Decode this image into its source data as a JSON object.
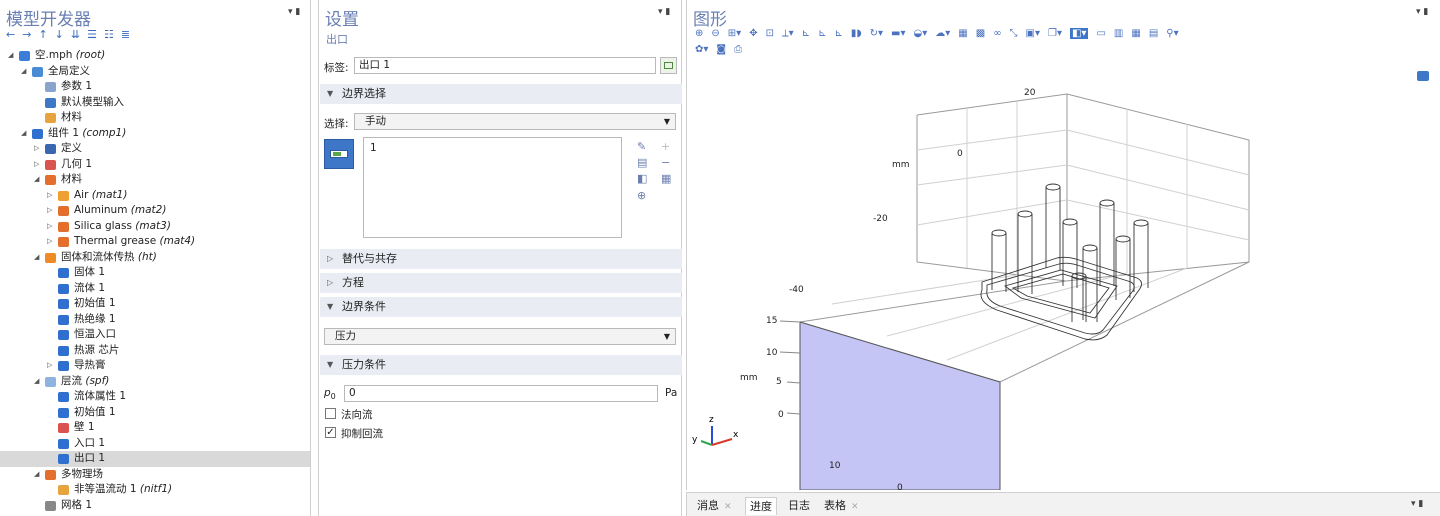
{
  "model_builder": {
    "title": "模型开发器",
    "nav": [
      "←",
      "→",
      "↑",
      "↓",
      "⇊",
      "☰",
      "☷",
      "≣"
    ],
    "tree": [
      {
        "label": "空.mph",
        "tag": "(root)",
        "icon": "file-icon",
        "color": "#3b7dd8",
        "expanded": true
      },
      {
        "label": "全局定义",
        "tag": "",
        "icon": "globe-icon",
        "color": "#4a8bd6",
        "expanded": true
      },
      {
        "label": "参数 1",
        "tag": "",
        "icon": "parameter-icon",
        "color": "#8aa3cc",
        "expanded": null
      },
      {
        "label": "默认模型输入",
        "tag": "",
        "icon": "model-input-icon",
        "color": "#3f77c8",
        "expanded": null
      },
      {
        "label": "材料",
        "tag": "",
        "icon": "material-icon",
        "color": "#e8a33d",
        "expanded": null
      },
      {
        "label": "组件 1",
        "tag": "(comp1)",
        "icon": "component-icon",
        "color": "#2f6fcf",
        "expanded": true
      },
      {
        "label": "定义",
        "tag": "",
        "icon": "definitions-icon",
        "color": "#3a66b0",
        "expanded": false
      },
      {
        "label": "几何 1",
        "tag": "",
        "icon": "geometry-icon",
        "color": "#d9534f",
        "expanded": false
      },
      {
        "label": "材料",
        "tag": "",
        "icon": "material-icon",
        "color": "#e46f2d",
        "expanded": true
      },
      {
        "label": "Air",
        "tag": "(mat1)",
        "icon": "material-icon",
        "color": "#f0a030",
        "expanded": false
      },
      {
        "label": "Aluminum",
        "tag": "(mat2)",
        "icon": "material-icon",
        "color": "#e46f2d",
        "expanded": false
      },
      {
        "label": "Silica glass",
        "tag": "(mat3)",
        "icon": "material-icon",
        "color": "#e46f2d",
        "expanded": false
      },
      {
        "label": "Thermal grease",
        "tag": "(mat4)",
        "icon": "material-icon",
        "color": "#e46f2d",
        "expanded": false
      },
      {
        "label": "固体和流体传热",
        "tag": "(ht)",
        "icon": "heat-transfer-icon",
        "color": "#f08a24",
        "expanded": true
      },
      {
        "label": "固体 1",
        "tag": "",
        "icon": "solid-icon",
        "color": "#2f6fcf",
        "expanded": null
      },
      {
        "label": "流体 1",
        "tag": "",
        "icon": "fluid-icon",
        "color": "#2f6fcf",
        "expanded": null
      },
      {
        "label": "初始值 1",
        "tag": "",
        "icon": "initial-values-icon",
        "color": "#2f6fcf",
        "expanded": null
      },
      {
        "label": "热绝缘 1",
        "tag": "",
        "icon": "insulation-icon",
        "color": "#2f6fcf",
        "expanded": null
      },
      {
        "label": "恒温入口",
        "tag": "",
        "icon": "inlet-icon",
        "color": "#2f6fcf",
        "expanded": null
      },
      {
        "label": "热源 芯片",
        "tag": "",
        "icon": "heat-source-icon",
        "color": "#2f6fcf",
        "expanded": null
      },
      {
        "label": "导热膏",
        "tag": "",
        "icon": "thin-layer-icon",
        "color": "#2f6fcf",
        "expanded": false
      },
      {
        "label": "层流",
        "tag": "(spf)",
        "icon": "laminar-flow-icon",
        "color": "#8fb3e0",
        "expanded": true
      },
      {
        "label": "流体属性 1",
        "tag": "",
        "icon": "fluid-properties-icon",
        "color": "#2f6fcf",
        "expanded": null
      },
      {
        "label": "初始值 1",
        "tag": "",
        "icon": "initial-values-icon",
        "color": "#2f6fcf",
        "expanded": null
      },
      {
        "label": "壁 1",
        "tag": "",
        "icon": "wall-icon",
        "color": "#d9534f",
        "expanded": null
      },
      {
        "label": "入口 1",
        "tag": "",
        "icon": "inlet-icon",
        "color": "#2f6fcf",
        "expanded": null
      },
      {
        "label": "出口 1",
        "tag": "",
        "icon": "outlet-icon",
        "color": "#2f6fcf",
        "expanded": null,
        "selected": true
      },
      {
        "label": "多物理场",
        "tag": "",
        "icon": "multiphysics-icon",
        "color": "#e46f2d",
        "expanded": true
      },
      {
        "label": "非等温流动 1",
        "tag": "(nitf1)",
        "icon": "nonisothermal-flow-icon",
        "color": "#e8a33d",
        "expanded": null
      },
      {
        "label": "网格 1",
        "tag": "",
        "icon": "mesh-icon",
        "color": "#888888",
        "expanded": null
      }
    ]
  },
  "settings": {
    "title": "设置",
    "subtitle": "出口",
    "label_caption": "标签:",
    "label_value": "出口 1",
    "section_boundary_selection": "边界选择",
    "selection_caption": "选择:",
    "selection_value": "手动",
    "selection_list": [
      "1"
    ],
    "section_override": "替代与共存",
    "section_equation": "方程",
    "section_boundary_condition": "边界条件",
    "boundary_condition_value": "压力",
    "section_pressure_conditions": "压力条件",
    "p0_symbol": "p",
    "p0_subscript": "0",
    "p0_value": "0",
    "p0_unit": "Pa",
    "normal_flow_label": "法向流",
    "normal_flow_checked": false,
    "suppress_backflow_label": "抑制回流",
    "suppress_backflow_checked": true
  },
  "graphics": {
    "title": "图形",
    "axis_labels": {
      "mm_top": "mm",
      "mm_left": "mm",
      "t20": "20",
      "t0": "0",
      "tm20": "-20",
      "tm40": "-40",
      "z15": "15",
      "z10": "10",
      "z5": "5",
      "z0": "0",
      "x10": "10",
      "x0": "0"
    },
    "triad": {
      "x": "x",
      "y": "y",
      "z": "z"
    },
    "highlight_color": "#c5c5f5"
  },
  "bottom_tabs": [
    {
      "label": "消息",
      "closable": true,
      "active": false
    },
    {
      "label": "进度",
      "closable": false,
      "active": true
    },
    {
      "label": "日志",
      "closable": false,
      "active": false
    },
    {
      "label": "表格",
      "closable": true,
      "active": false
    }
  ]
}
